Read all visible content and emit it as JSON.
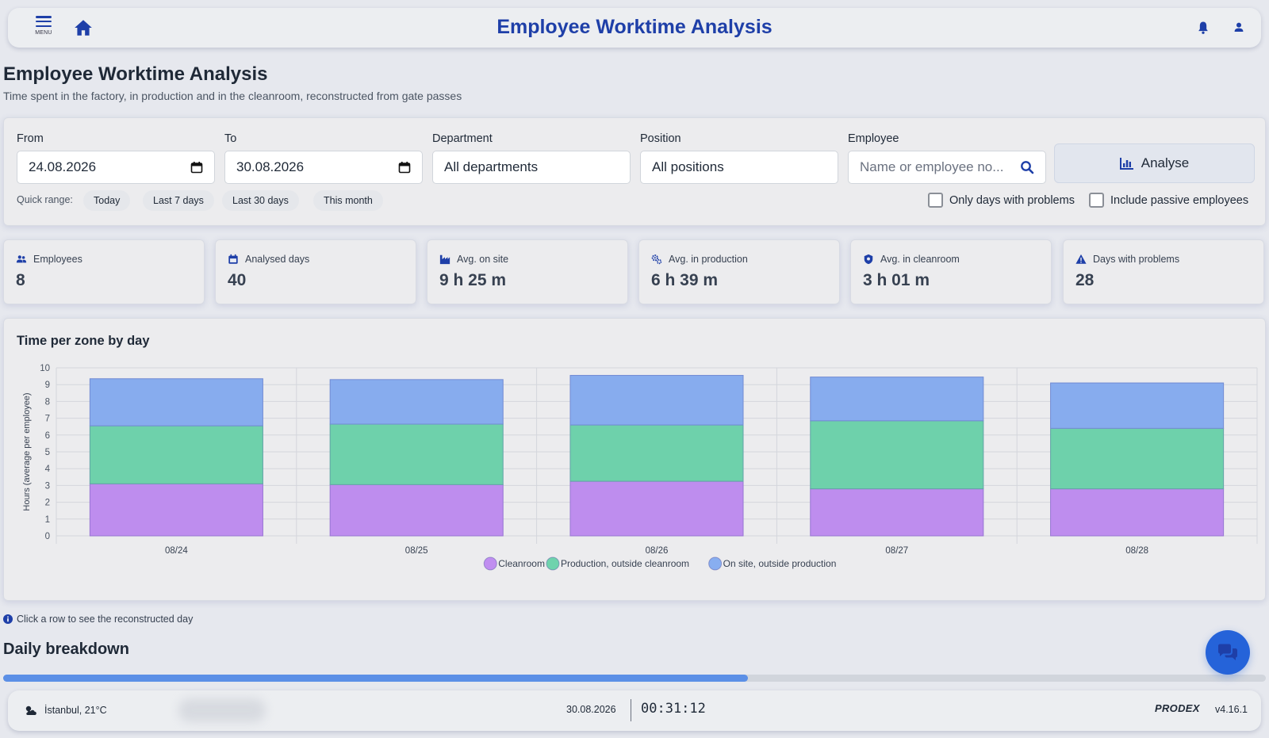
{
  "app": {
    "title": "Employee Worktime Analysis",
    "menu_label": "MENU"
  },
  "page": {
    "title": "Employee Worktime Analysis",
    "subtitle": "Time spent in the factory, in production and in the cleanroom, reconstructed from gate passes"
  },
  "filters": {
    "from_label": "From",
    "from_value": "24.08.2026",
    "to_label": "To",
    "to_value": "30.08.2026",
    "department_label": "Department",
    "department_value": "All departments",
    "position_label": "Position",
    "position_value": "All positions",
    "employee_label": "Employee",
    "employee_placeholder": "Name or employee no...",
    "analyse_label": "Analyse",
    "quick_range_label": "Quick range:",
    "quick_ranges": [
      "Today",
      "Last 7 days",
      "Last 30 days",
      "This month"
    ],
    "only_problems_label": "Only days with problems",
    "only_problems_checked": false,
    "include_passive_label": "Include passive employees",
    "include_passive_checked": false
  },
  "stats": [
    {
      "label": "Employees",
      "value": "8",
      "icon": "users-icon"
    },
    {
      "label": "Analysed days",
      "value": "40",
      "icon": "calendar-icon"
    },
    {
      "label": "Avg. on site",
      "value": "9 h 25 m",
      "icon": "factory-icon"
    },
    {
      "label": "Avg. in production",
      "value": "6 h 39 m",
      "icon": "gears-icon"
    },
    {
      "label": "Avg. in cleanroom",
      "value": "3 h 01 m",
      "icon": "shield-icon"
    },
    {
      "label": "Days with problems",
      "value": "28",
      "icon": "warning-icon"
    }
  ],
  "chart_data": {
    "type": "bar",
    "stacked": true,
    "title": "Time per zone by day",
    "ylabel": "Hours (average per employee)",
    "ylim": [
      0,
      10
    ],
    "yticks": [
      0,
      1,
      2,
      3,
      4,
      5,
      6,
      7,
      8,
      9,
      10
    ],
    "grid": true,
    "legend_position": "bottom",
    "categories": [
      "08/24",
      "08/25",
      "08/26",
      "08/27",
      "08/28"
    ],
    "series": [
      {
        "name": "Cleanroom",
        "color": "#c08ef0",
        "values": [
          3.1,
          3.05,
          3.25,
          2.8,
          2.8
        ]
      },
      {
        "name": "Production, outside cleanroom",
        "color": "#6fd3ad",
        "values": [
          3.45,
          3.6,
          3.35,
          4.05,
          3.6
        ]
      },
      {
        "name": "On site, outside production",
        "color": "#88aef0",
        "values": [
          2.8,
          2.65,
          2.95,
          2.6,
          2.7
        ]
      }
    ]
  },
  "info_note": "Click a row to see the reconstructed day",
  "daily_breakdown_title": "Daily breakdown",
  "progress_fraction": 0.59,
  "statusbar": {
    "weather": "İstanbul, 21°C",
    "date": "30.08.2026",
    "clock": "00:31:12",
    "logo": "PRODEX",
    "version": "v4.16.1"
  },
  "colors": {
    "accent": "#1e3fa8",
    "fab": "#2563d9",
    "progress": "#5b8fe6"
  }
}
